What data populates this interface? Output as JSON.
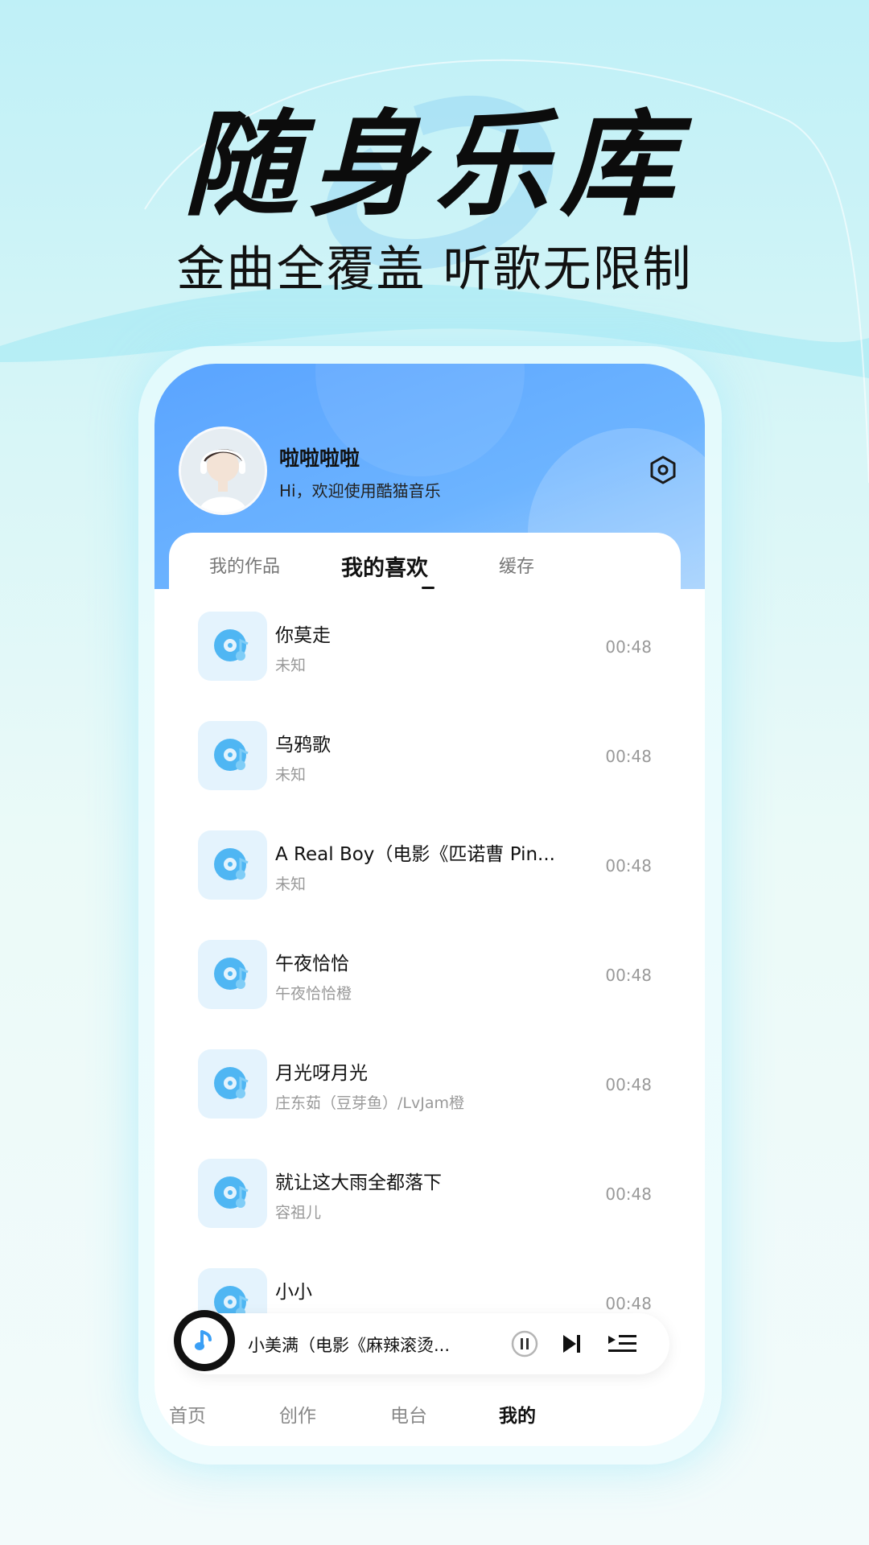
{
  "headline": "随身乐库",
  "subheadline": "金曲全覆盖 听歌无限制",
  "profile": {
    "username": "啦啦啦啦",
    "welcome": "Hi，欢迎使用酷猫音乐"
  },
  "tabs": [
    {
      "label": "我的作品",
      "active": false
    },
    {
      "label": "我的喜欢",
      "active": true
    },
    {
      "label": "缓存",
      "active": false
    }
  ],
  "songs": [
    {
      "title": "你莫走",
      "artist": "未知",
      "duration": "00:48"
    },
    {
      "title": "乌鸦歌",
      "artist": "未知",
      "duration": "00:48"
    },
    {
      "title": "A Real Boy（电影《匹诺曹 Pin...",
      "artist": "未知",
      "duration": "00:48"
    },
    {
      "title": "午夜恰恰",
      "artist": "午夜恰恰橙",
      "duration": "00:48"
    },
    {
      "title": "月光呀月光",
      "artist": "庄东茹（豆芽鱼）/LvJam橙",
      "duration": "00:48"
    },
    {
      "title": "就让这大雨全都落下",
      "artist": "容祖儿",
      "duration": "00:48"
    },
    {
      "title": "小小",
      "artist": "",
      "duration": "00:48"
    }
  ],
  "mini_player": {
    "title": "小美满（电影《麻辣滚烫...",
    "state": "playing"
  },
  "bottom_nav": [
    {
      "label": "首页",
      "active": false
    },
    {
      "label": "创作",
      "active": false
    },
    {
      "label": "电台",
      "active": false
    },
    {
      "label": "我的",
      "active": true
    }
  ],
  "colors": {
    "accent": "#5aa4ff",
    "icon_tile": "#e4f3fd",
    "disc": "#4fb6f3"
  }
}
